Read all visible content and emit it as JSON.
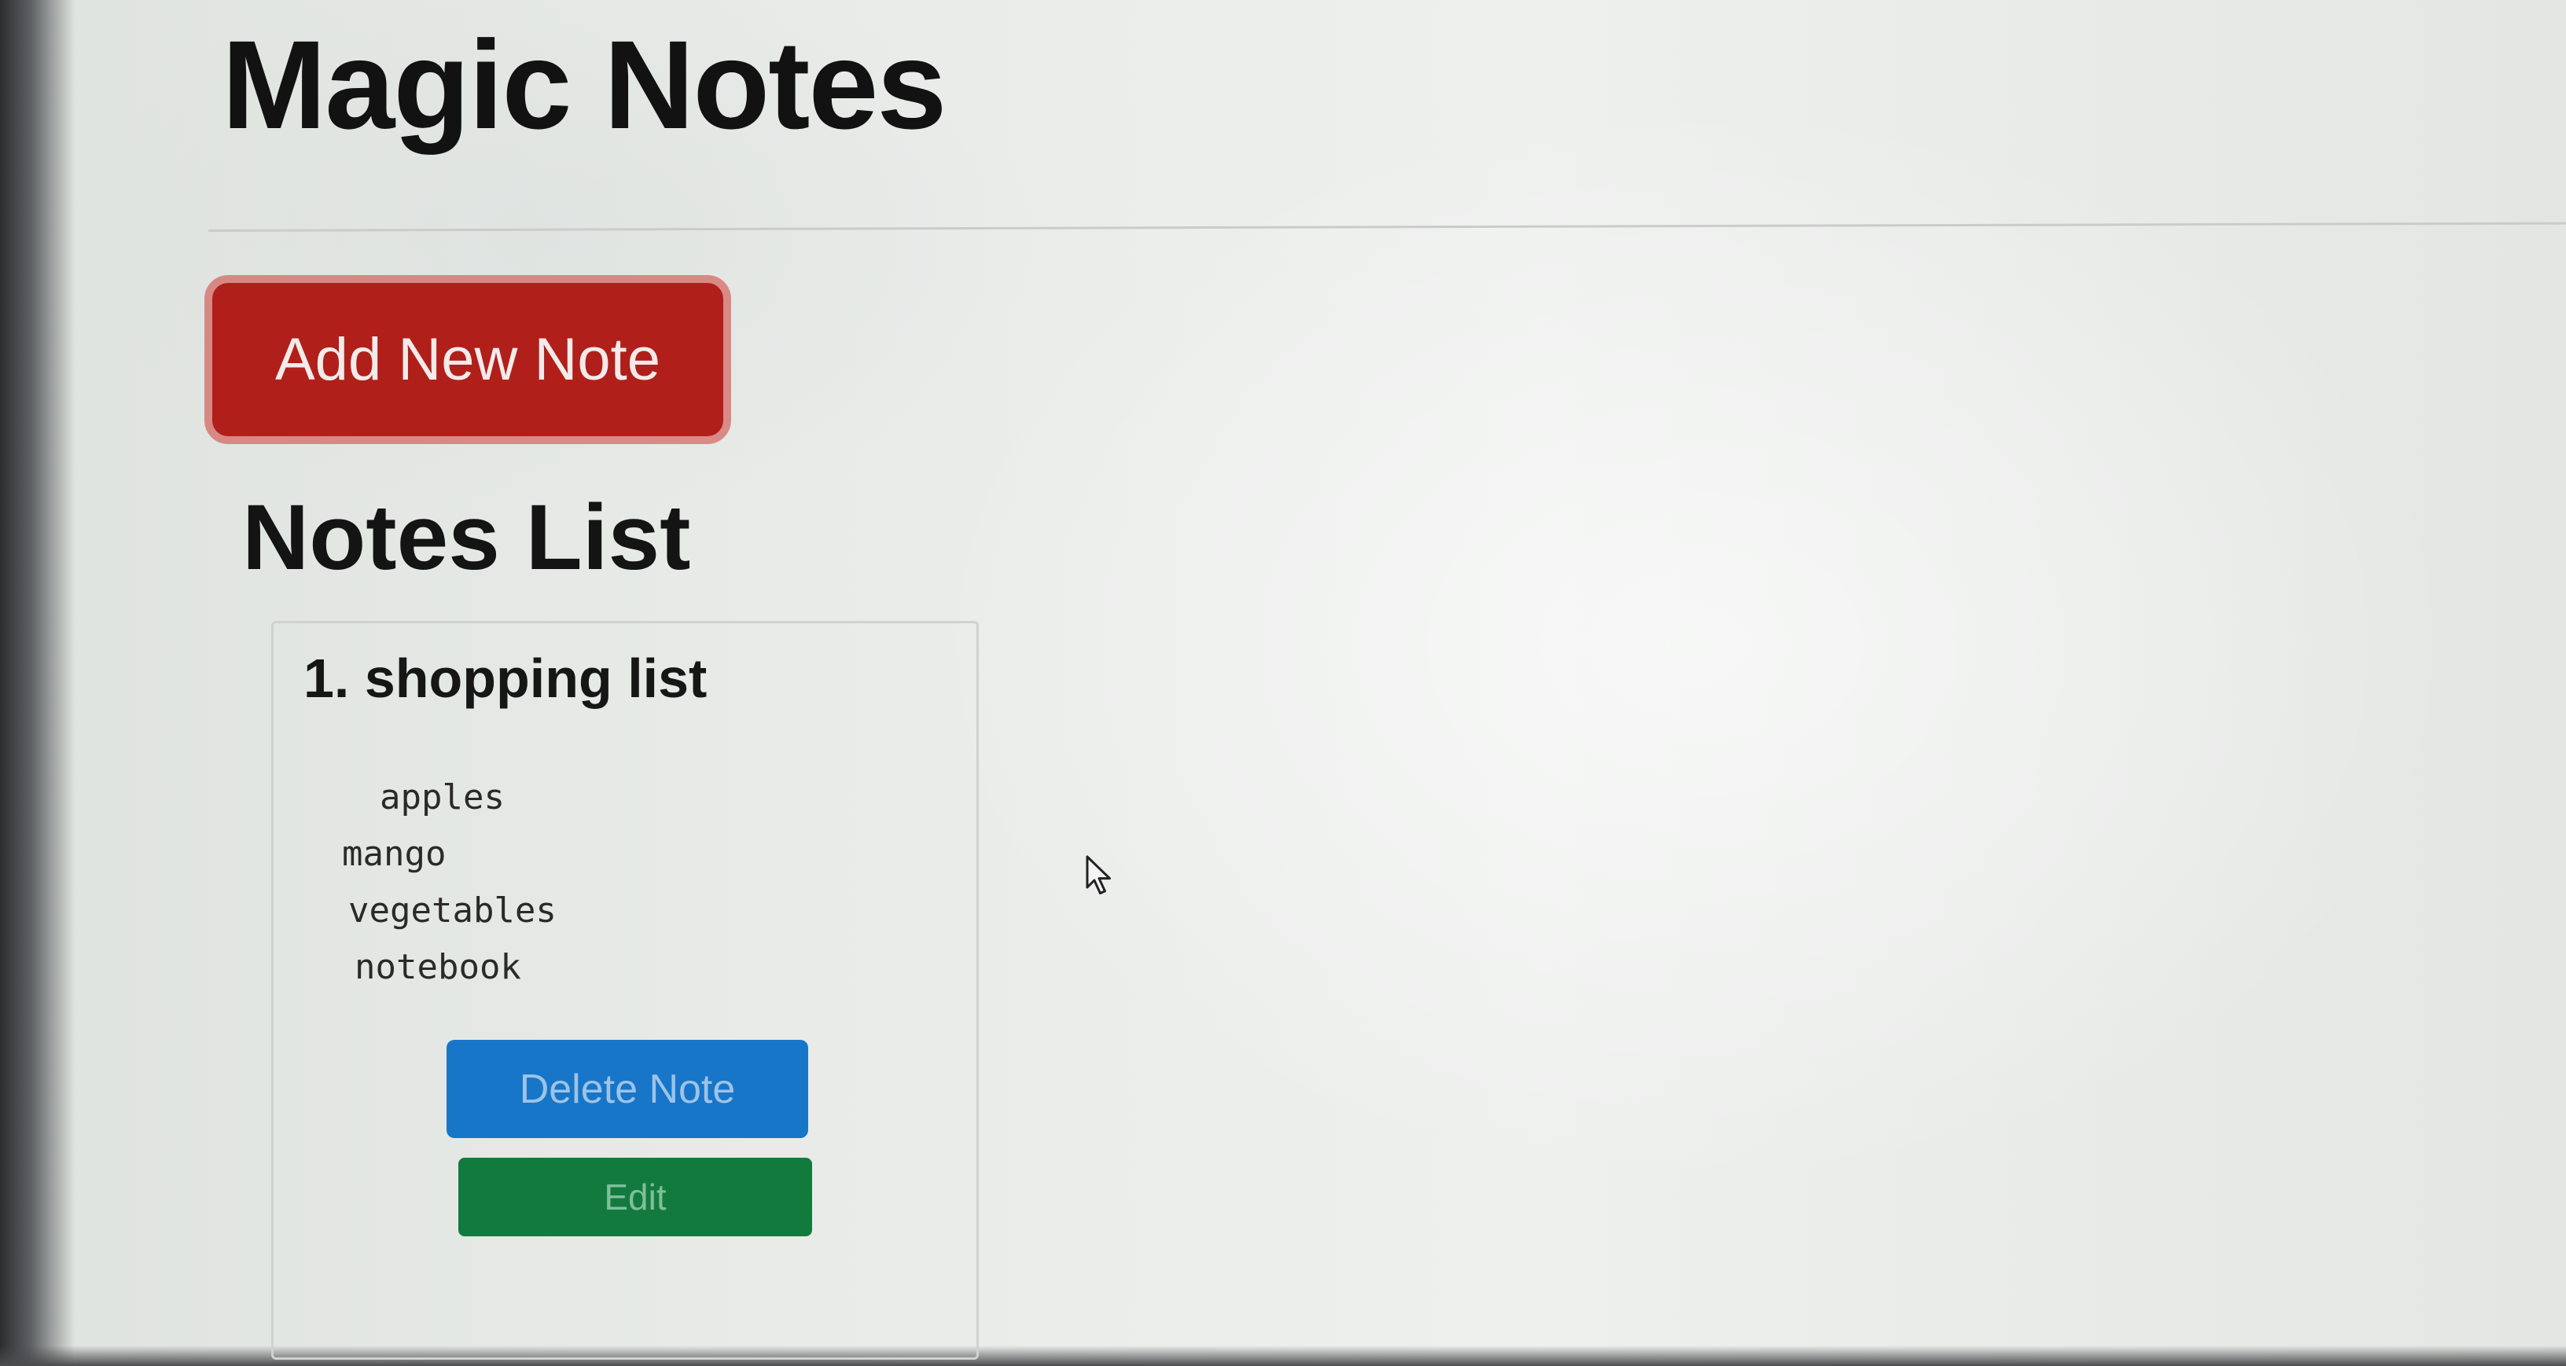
{
  "app": {
    "title": "Magic Notes"
  },
  "toolbar": {
    "add_note_label": "Add New Note"
  },
  "notes_section": {
    "title": "Notes List"
  },
  "notes": [
    {
      "title": "1. shopping list",
      "lines": [
        "apples",
        "mango",
        "vegetables",
        "notebook"
      ],
      "delete_label": "Delete Note",
      "edit_label": "Edit"
    }
  ],
  "colors": {
    "add_button": "#b01f1a",
    "delete_button": "#1876c8",
    "edit_button": "#137a3e",
    "background": "#e4e7e4"
  },
  "icons": {
    "cursor": "mouse-pointer-icon"
  }
}
